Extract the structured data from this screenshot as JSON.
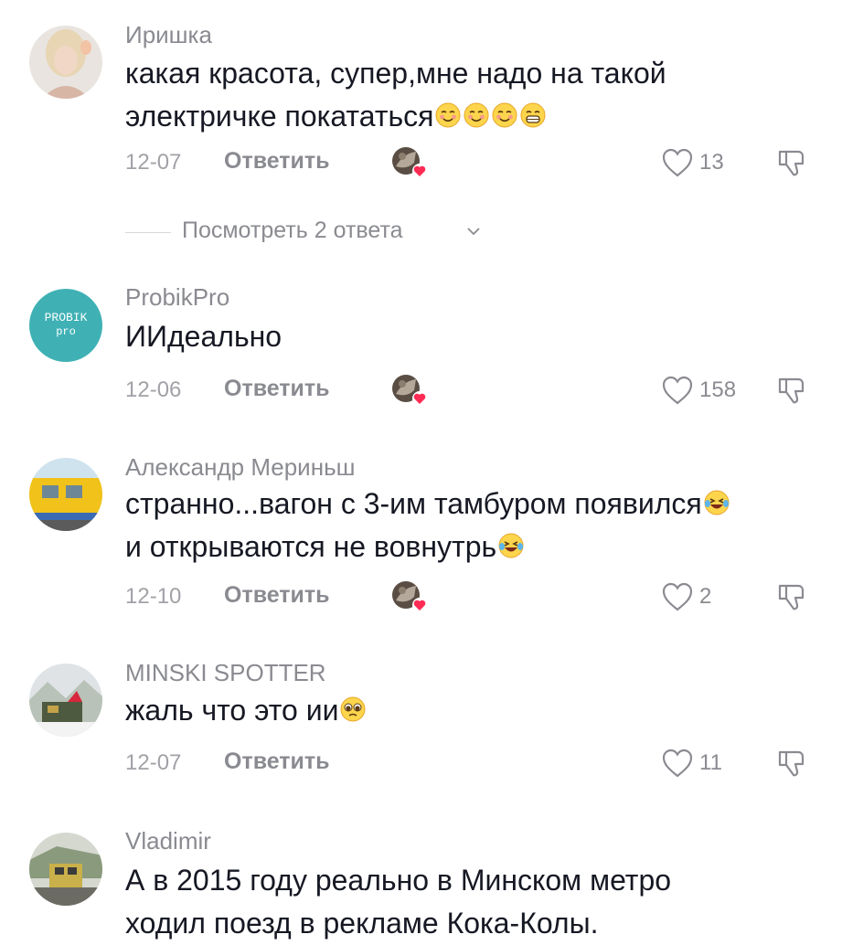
{
  "comments": [
    {
      "username": "Иришка",
      "text": "какая красота, супер,мне надо на такой электричке покататься",
      "emojis": [
        "smiling-blush-emoji",
        "smiling-blush-emoji",
        "smiling-blush-emoji",
        "grinning-emoji"
      ],
      "date": "12-07",
      "reply_label": "Ответить",
      "likes": "13",
      "creator_liked": true
    },
    {
      "username": "ProbikPro",
      "avatar_text": [
        "PROBIK",
        "pro"
      ],
      "text": "ИИдеально",
      "date": "12-06",
      "reply_label": "Ответить",
      "likes": "158",
      "creator_liked": true
    },
    {
      "username": "Александр Мериньш",
      "text_line1": "странно...вагон с 3-им тамбуром появился",
      "text_line2": "и открываются не вовнутрь",
      "emojis": [
        "laughing-tears-emoji",
        "laughing-tears-emoji"
      ],
      "date": "12-10",
      "reply_label": "Ответить",
      "likes": "2",
      "creator_liked": true
    },
    {
      "username": "MINSKI SPOTTER",
      "text": "жаль что это ии",
      "emojis": [
        "pleading-face-emoji"
      ],
      "date": "12-07",
      "reply_label": "Ответить",
      "likes": "11",
      "creator_liked": false
    },
    {
      "username": "Vladimir",
      "text_line1": "А в 2015 году реально в Минском метро",
      "text_line2": "ходил поезд в рекламе Кока-Колы."
    }
  ],
  "view_replies": {
    "label": "Посмотреть 2 ответа"
  },
  "colors": {
    "text": "#161823",
    "secondary": "#8a8b91",
    "creator_heart": "#fe2c55",
    "probik_avatar_bg": "#3fb1b5"
  },
  "icons": {
    "like": "heart-outline-icon",
    "dislike": "thumbs-down-outline-icon",
    "view_replies_chevron": "chevron-down-icon"
  }
}
